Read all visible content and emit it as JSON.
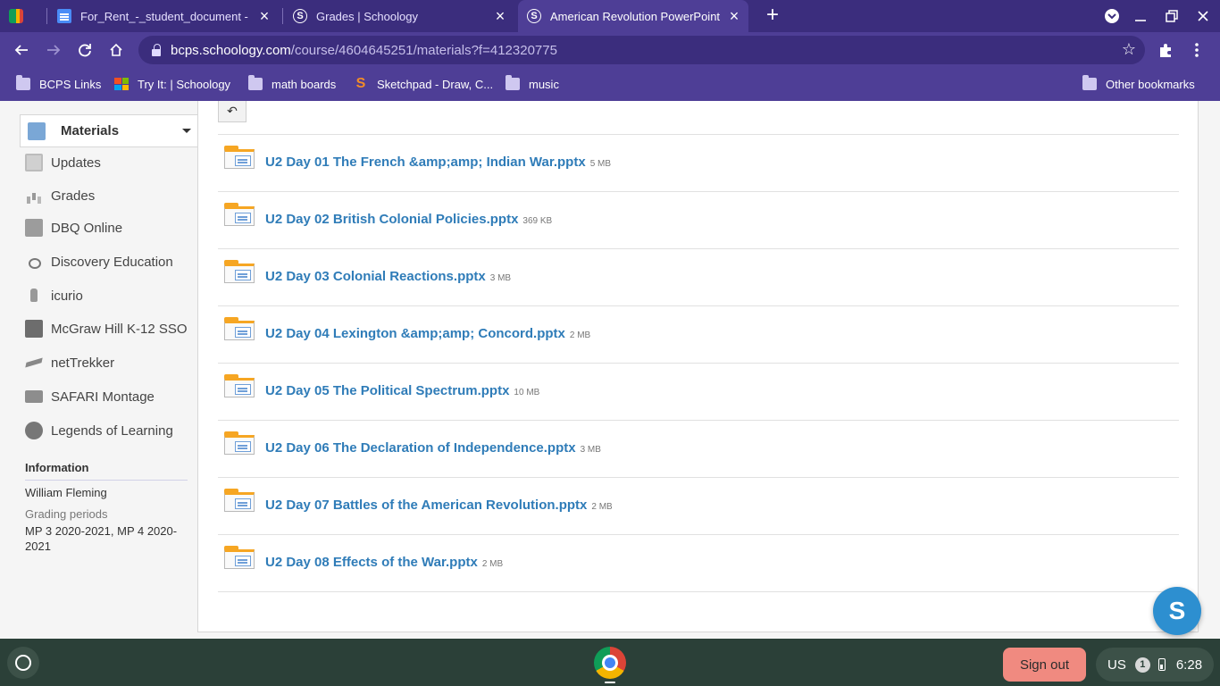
{
  "browser": {
    "tabs": [
      {
        "title": "For_Rent_-_student_document - G",
        "icon": "docs-icon",
        "active": false
      },
      {
        "title": "Grades | Schoology",
        "icon": "schoology-icon",
        "active": false
      },
      {
        "title": "American Revolution PowerPoint",
        "icon": "schoology-icon",
        "active": true
      }
    ],
    "new_tab": "+",
    "url_host": "bcps.schoology.com",
    "url_path": "/course/4604645251/materials?f=412320775",
    "bookmarks": [
      {
        "label": "BCPS Links",
        "icon": "folder-icon"
      },
      {
        "label": "Try It: | Schoology",
        "icon": "microsoft-icon"
      },
      {
        "label": "math boards",
        "icon": "folder-icon"
      },
      {
        "label": "Sketchpad - Draw, C...",
        "icon": "sketchpad-icon"
      },
      {
        "label": "music",
        "icon": "folder-icon"
      }
    ],
    "other_bookmarks": "Other bookmarks",
    "accent": "#4e3e96"
  },
  "sidebar": {
    "active": {
      "label": "Materials",
      "icon": "materials-icon"
    },
    "items": [
      {
        "label": "Updates",
        "icon": "updates-icon"
      },
      {
        "label": "Grades",
        "icon": "grades-icon"
      },
      {
        "label": "DBQ Online",
        "icon": "dbq-icon"
      },
      {
        "label": "Discovery Education",
        "icon": "discovery-icon"
      },
      {
        "label": "icurio",
        "icon": "icurio-icon"
      },
      {
        "label": "McGraw Hill K-12 SSO",
        "icon": "mcgraw-hill-icon"
      },
      {
        "label": "netTrekker",
        "icon": "nettrekker-icon"
      },
      {
        "label": "SAFARI Montage",
        "icon": "safari-montage-icon"
      },
      {
        "label": "Legends of Learning",
        "icon": "legends-icon"
      }
    ],
    "info": {
      "heading": "Information",
      "teacher": "William Fleming",
      "periods_label": "Grading periods",
      "periods_value": "MP 3 2020-2021, MP 4 2020-2021"
    }
  },
  "materials": {
    "back_label": "↶",
    "files": [
      {
        "name": "U2 Day 01 The French &amp;amp; Indian War.pptx",
        "size": "5 MB"
      },
      {
        "name": "U2 Day 02 British Colonial Policies.pptx",
        "size": "369 KB"
      },
      {
        "name": "U2 Day 03 Colonial Reactions.pptx",
        "size": "3 MB"
      },
      {
        "name": "U2 Day 04 Lexington &amp;amp; Concord.pptx",
        "size": "2 MB"
      },
      {
        "name": "U2 Day 05 The Political Spectrum.pptx",
        "size": "10 MB"
      },
      {
        "name": "U2 Day 06 The Declaration of Independence.pptx",
        "size": "3 MB"
      },
      {
        "name": "U2 Day 07 Battles of the American Revolution.pptx",
        "size": "2 MB"
      },
      {
        "name": "U2 Day 08 Effects of the War.pptx",
        "size": "2 MB"
      }
    ],
    "link_color": "#2f7cb8"
  },
  "help_bubble": "S",
  "shelf": {
    "sign_out": "Sign out",
    "ime": "US",
    "notification_count": "1",
    "time": "6:28"
  }
}
